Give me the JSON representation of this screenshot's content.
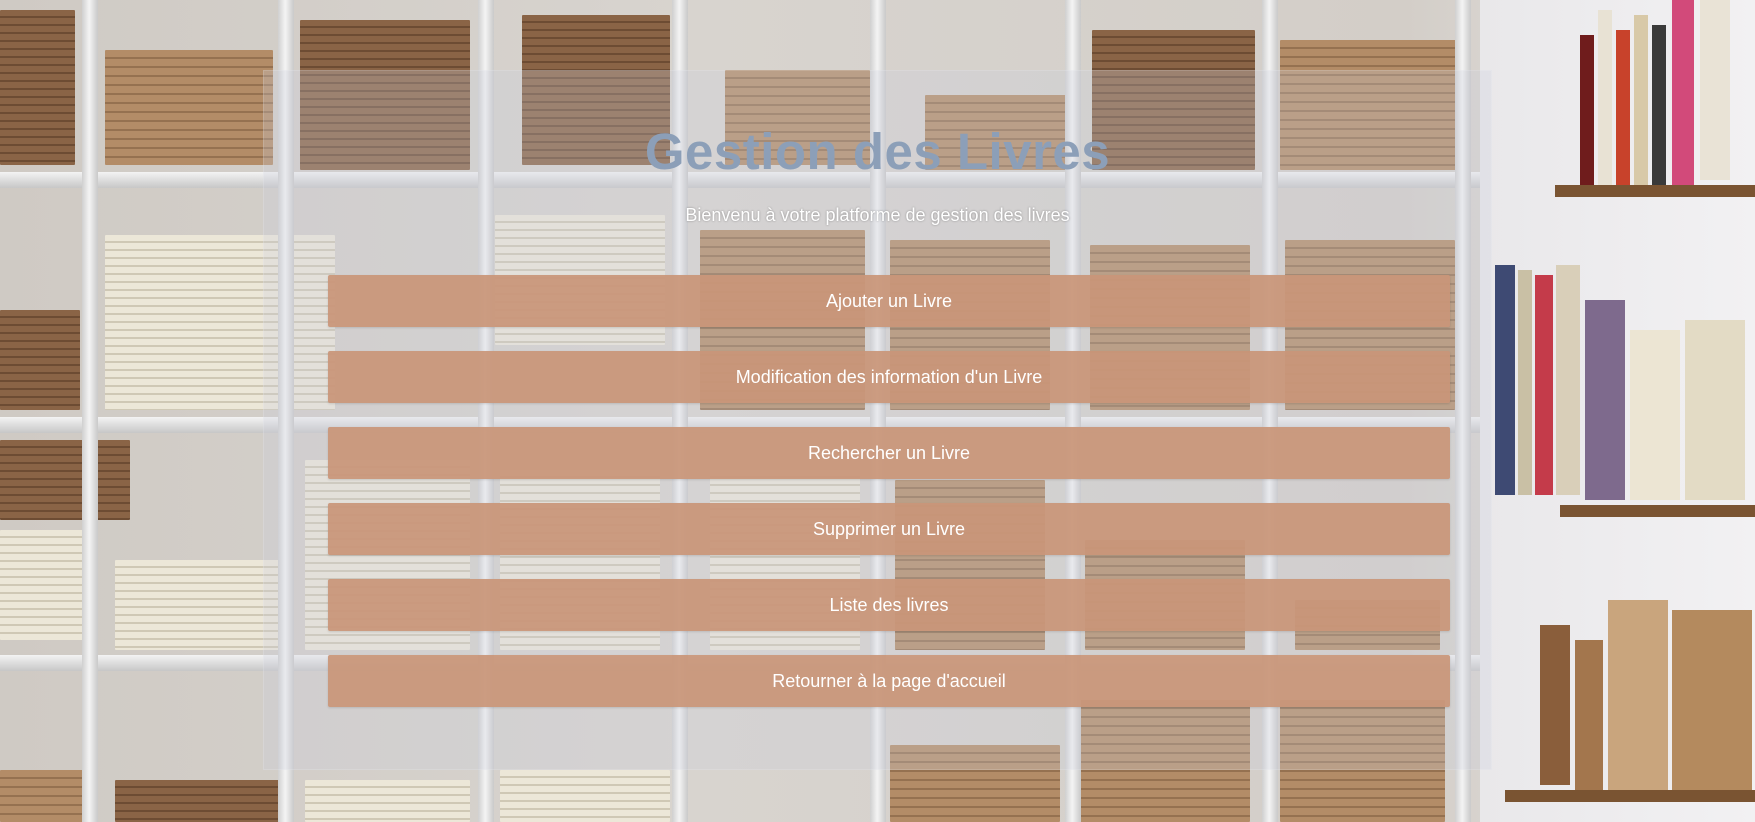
{
  "page": {
    "title": "Gestion des Livres",
    "subtitle": "Bienvenu à votre platforme de gestion des livres"
  },
  "menu": {
    "items": [
      {
        "label": "Ajouter un Livre"
      },
      {
        "label": "Modification des information d'un Livre"
      },
      {
        "label": "Rechercher un Livre"
      },
      {
        "label": "Supprimer un Livre"
      },
      {
        "label": "Liste des livres"
      },
      {
        "label": "Retourner à la page d'accueil"
      }
    ]
  },
  "colors": {
    "title": "#8c9fb8",
    "button_bg": "#c99678",
    "button_text": "#ffffff",
    "panel_overlay": "#ccd2e0"
  }
}
